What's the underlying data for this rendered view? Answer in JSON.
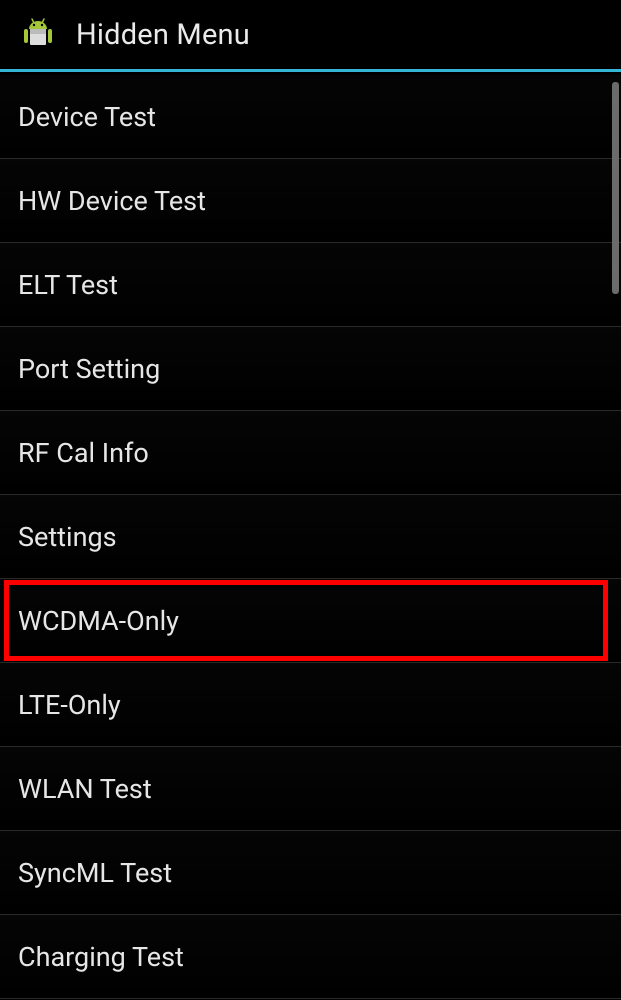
{
  "header": {
    "title": "Hidden Menu",
    "icon": "android-box-icon"
  },
  "menu": {
    "items": [
      {
        "label": "Device Test",
        "highlighted": false
      },
      {
        "label": "HW Device Test",
        "highlighted": false
      },
      {
        "label": "ELT Test",
        "highlighted": false
      },
      {
        "label": "Port Setting",
        "highlighted": false
      },
      {
        "label": "RF Cal Info",
        "highlighted": false
      },
      {
        "label": "Settings",
        "highlighted": false
      },
      {
        "label": "WCDMA-Only",
        "highlighted": true
      },
      {
        "label": "LTE-Only",
        "highlighted": false
      },
      {
        "label": "WLAN Test",
        "highlighted": false
      },
      {
        "label": "SyncML Test",
        "highlighted": false
      },
      {
        "label": "Charging Test",
        "highlighted": false
      }
    ]
  },
  "colors": {
    "accent": "#36b6d6",
    "highlight_border": "#ff0000",
    "android_green": "#a4c639"
  }
}
